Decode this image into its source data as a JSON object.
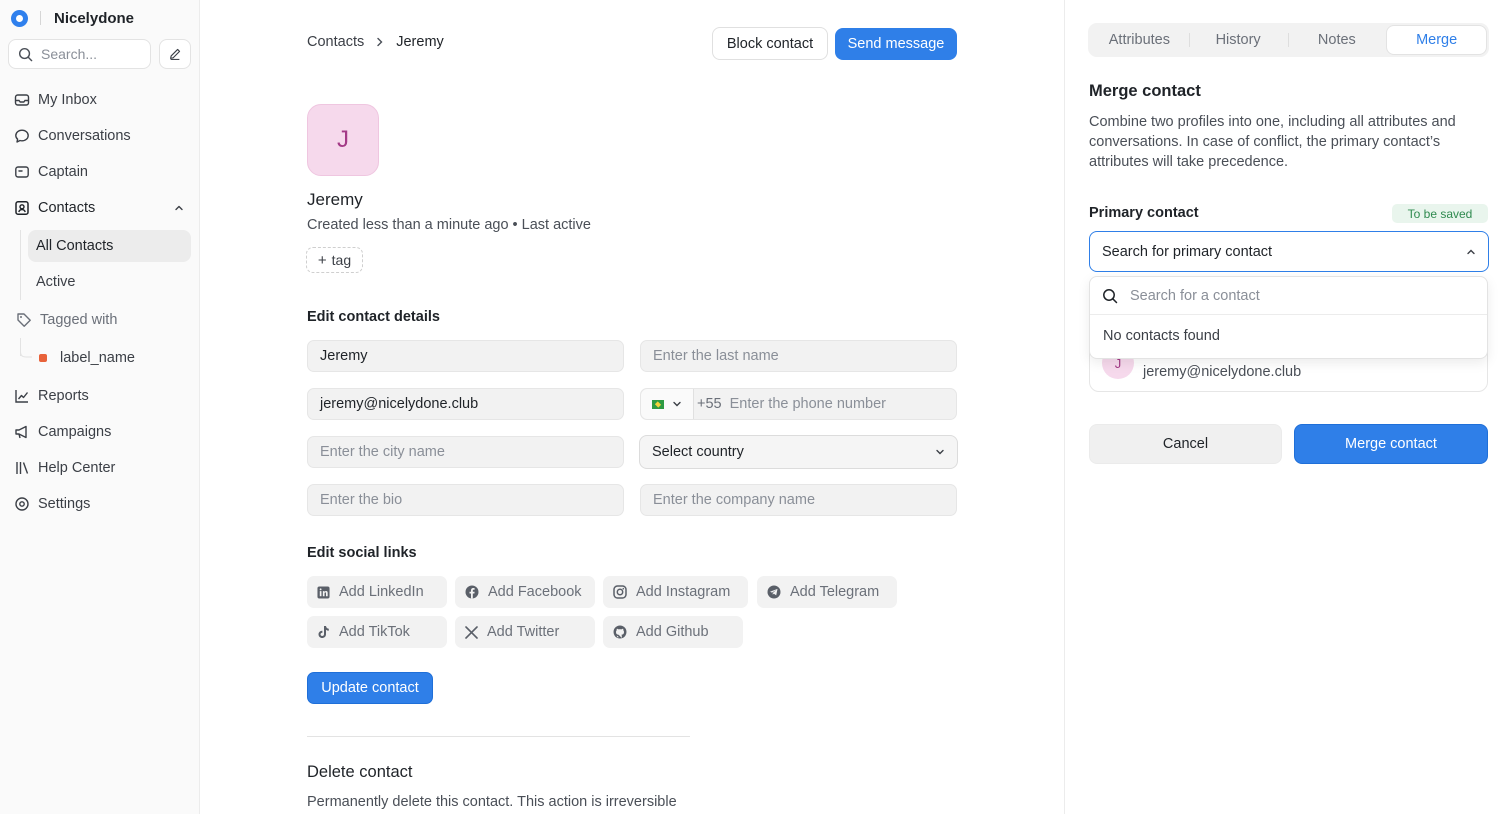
{
  "sidebar": {
    "brand": "Nicelydone",
    "search_placeholder": "Search...",
    "nav": {
      "inbox": "My Inbox",
      "conversations": "Conversations",
      "captain": "Captain",
      "contacts": "Contacts",
      "contacts_sub": [
        "All Contacts",
        "Active"
      ],
      "tagged_with": "Tagged with",
      "label": "label_name",
      "reports": "Reports",
      "campaigns": "Campaigns",
      "help_center": "Help Center",
      "settings": "Settings"
    },
    "label_color": "#e8623a"
  },
  "header": {
    "breadcrumb": [
      "Contacts",
      "Jeremy"
    ],
    "block_label": "Block contact",
    "send_label": "Send message"
  },
  "contact": {
    "initial": "J",
    "name": "Jeremy",
    "meta": "Created less than a minute ago • Last active",
    "tag_label": "tag"
  },
  "edit": {
    "title": "Edit contact details",
    "first_name": "Jeremy",
    "last_name_placeholder": "Enter the last name",
    "email": "jeremy@nicelydone.club",
    "dial_code": "+55",
    "phone_placeholder": "Enter the phone number",
    "city_placeholder": "Enter the city name",
    "country_select": "Select country",
    "bio_placeholder": "Enter the bio",
    "company_placeholder": "Enter the company name"
  },
  "social": {
    "title": "Edit social links",
    "links": [
      "Add LinkedIn",
      "Add Facebook",
      "Add Instagram",
      "Add Telegram",
      "Add TikTok",
      "Add Twitter",
      "Add Github"
    ]
  },
  "update_label": "Update contact",
  "delete": {
    "title": "Delete contact",
    "desc": "Permanently delete this contact. This action is irreversible"
  },
  "panel": {
    "tabs": [
      "Attributes",
      "History",
      "Notes",
      "Merge"
    ],
    "active_tab": "Merge",
    "merge_title": "Merge contact",
    "merge_desc": "Combine two profiles into one, including all attributes and conversations. In case of conflict, the primary contact’s attributes will take precedence.",
    "primary_label": "Primary contact",
    "badge": "To be saved",
    "primary_select": "Search for primary contact",
    "dropdown_placeholder": "Search for a contact",
    "dropdown_empty": "No contacts found",
    "card_initial": "J",
    "card_email": "jeremy@nicelydone.club",
    "cancel_label": "Cancel",
    "merge_label": "Merge contact"
  },
  "colors": {
    "accent": "#2f7fe8",
    "avatar_bg": "#f6d9ec",
    "avatar_text": "#a33a86",
    "badge_bg": "#e9f5ed",
    "badge_text": "#2f8a4f"
  }
}
